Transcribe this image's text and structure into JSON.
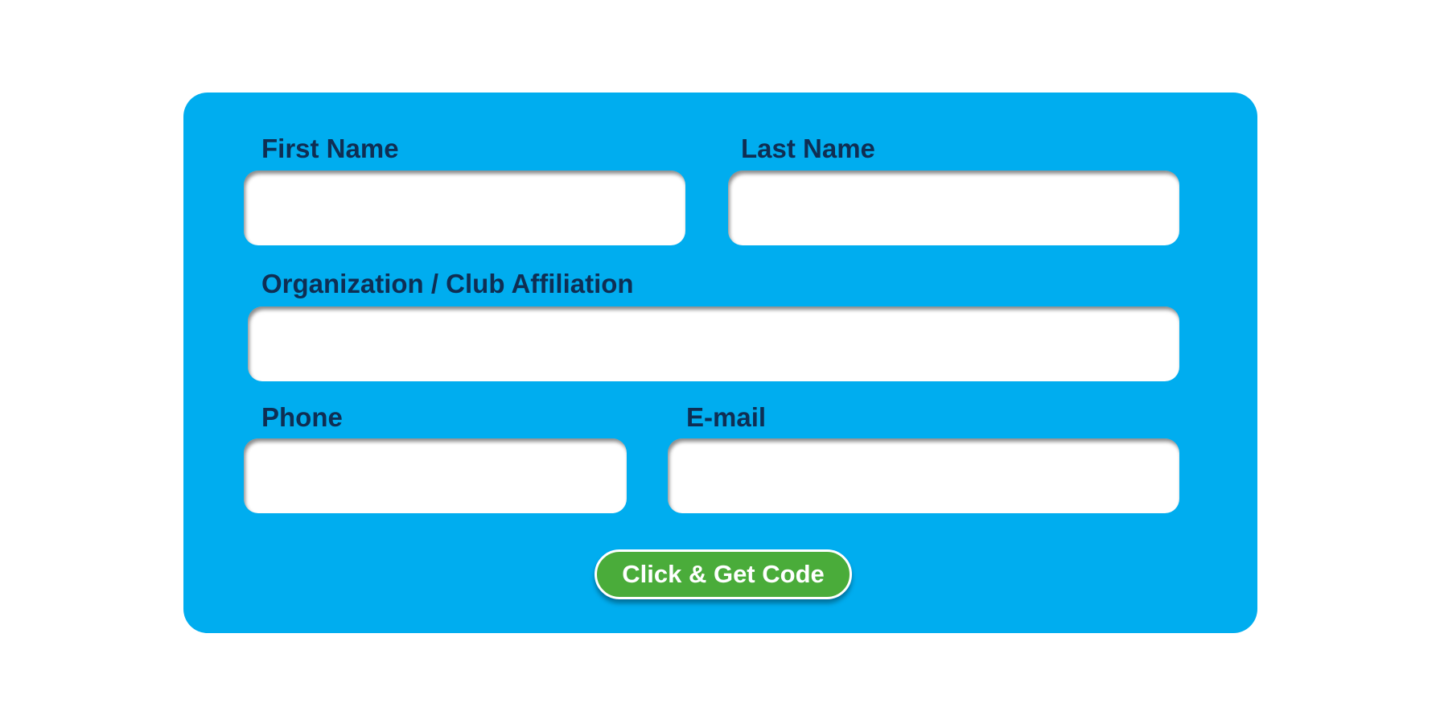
{
  "form": {
    "first_name": {
      "label": "First Name",
      "value": "",
      "placeholder": ""
    },
    "last_name": {
      "label": "Last Name",
      "value": "",
      "placeholder": ""
    },
    "organization": {
      "label": "Organization / Club Affiliation",
      "value": "",
      "placeholder": ""
    },
    "phone": {
      "label": "Phone",
      "value": "",
      "placeholder": ""
    },
    "email": {
      "label": "E-mail",
      "value": "",
      "placeholder": ""
    },
    "submit_label": "Click & Get Code"
  },
  "colors": {
    "panel_background": "#00adef",
    "label_text": "#0f2e53",
    "button_background": "#4aac3a",
    "button_text": "#ffffff",
    "page_background": "#ffffff"
  }
}
